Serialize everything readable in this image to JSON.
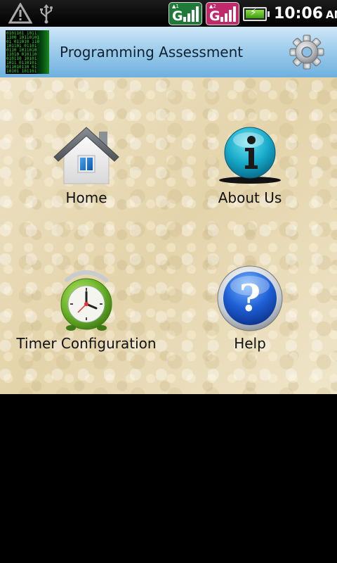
{
  "status_bar": {
    "time": "10:06",
    "ampm": "AM",
    "icons": [
      "warning-icon",
      "usb-icon",
      "sim1-signal-icon",
      "sim2-signal-icon",
      "battery-charging-icon"
    ],
    "sim1": {
      "label": "G",
      "color": "#1f7a3a"
    },
    "sim2": {
      "label": "G",
      "color": "#c02a6a"
    }
  },
  "title_bar": {
    "title": "Programming Assessment",
    "logo_icon": "binary-code-logo",
    "settings_icon": "gear-icon"
  },
  "menu": {
    "items": [
      {
        "label": "Home",
        "icon": "home-icon"
      },
      {
        "label": "About Us",
        "icon": "info-icon"
      },
      {
        "label": "Timer Configuration",
        "icon": "alarm-clock-icon"
      },
      {
        "label": "Help",
        "icon": "help-icon"
      }
    ]
  },
  "colors": {
    "title_bar": "#9fcdec",
    "background": "#e9dcb8",
    "status_bar": "#000000"
  }
}
